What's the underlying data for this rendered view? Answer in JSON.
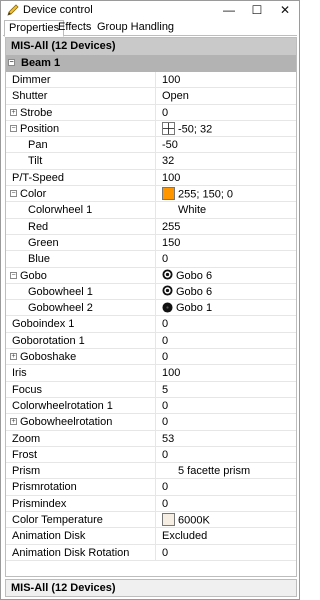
{
  "window": {
    "title": "Device control",
    "controls": {
      "minimize": "—",
      "maximize": "☐",
      "close": "✕"
    }
  },
  "tabs": [
    "Properties",
    "Effects",
    "Group Handling"
  ],
  "panel": {
    "header": "MIS-All (12 Devices)",
    "section": "Beam 1",
    "rows": [
      {
        "name": "Dimmer",
        "value": "100",
        "level": 0
      },
      {
        "name": "Shutter",
        "value": "Open",
        "level": 0
      },
      {
        "name": "Strobe",
        "value": "0",
        "level": 0,
        "toggle": "+"
      },
      {
        "name": "Position",
        "value": "-50; 32",
        "level": 0,
        "toggle": "−",
        "icon": "position-grid-icon"
      },
      {
        "name": "Pan",
        "value": "-50",
        "level": 1
      },
      {
        "name": "Tilt",
        "value": "32",
        "level": 1
      },
      {
        "name": "P/T-Speed",
        "value": "100",
        "level": 0
      },
      {
        "name": "Color",
        "value": "255; 150; 0",
        "level": 0,
        "toggle": "−",
        "icon": "color-swatch-icon",
        "color": "#ff9600"
      },
      {
        "name": "Colorwheel 1",
        "value": "White",
        "level": 1,
        "indent": true
      },
      {
        "name": "Red",
        "value": "255",
        "level": 1
      },
      {
        "name": "Green",
        "value": "150",
        "level": 1
      },
      {
        "name": "Blue",
        "value": "0",
        "level": 1
      },
      {
        "name": "Gobo",
        "value": "Gobo 6",
        "level": 0,
        "toggle": "−",
        "icon": "gobo-6-icon"
      },
      {
        "name": "Gobowheel 1",
        "value": "Gobo 6",
        "level": 1,
        "icon": "gobo-6-icon"
      },
      {
        "name": "Gobowheel 2",
        "value": "Gobo 1",
        "level": 1,
        "icon": "gobo-1-icon"
      },
      {
        "name": "Goboindex 1",
        "value": "0",
        "level": 0
      },
      {
        "name": "Goborotation 1",
        "value": "0",
        "level": 0
      },
      {
        "name": "Goboshake",
        "value": "0",
        "level": 0,
        "toggle": "+"
      },
      {
        "name": "Iris",
        "value": "100",
        "level": 0
      },
      {
        "name": "Focus",
        "value": "5",
        "level": 0
      },
      {
        "name": "Colorwheelrotation 1",
        "value": "0",
        "level": 0
      },
      {
        "name": "Gobowheelrotation",
        "value": "0",
        "level": 0,
        "toggle": "+"
      },
      {
        "name": "Zoom",
        "value": "53",
        "level": 0
      },
      {
        "name": "Frost",
        "value": "0",
        "level": 0
      },
      {
        "name": "Prism",
        "value": "5 facette prism",
        "level": 0,
        "indent": true
      },
      {
        "name": "Prismrotation",
        "value": "0",
        "level": 0
      },
      {
        "name": "Prismindex",
        "value": "0",
        "level": 0
      },
      {
        "name": "Color Temperature",
        "value": "6000K",
        "level": 0,
        "icon": "color-temp-swatch-icon",
        "color": "#f6eee2"
      },
      {
        "name": "Animation Disk",
        "value": "Excluded",
        "level": 0
      },
      {
        "name": "Animation Disk Rotation",
        "value": "0",
        "level": 0
      }
    ]
  },
  "statusbar": {
    "text": "MIS-All (12 Devices)"
  }
}
